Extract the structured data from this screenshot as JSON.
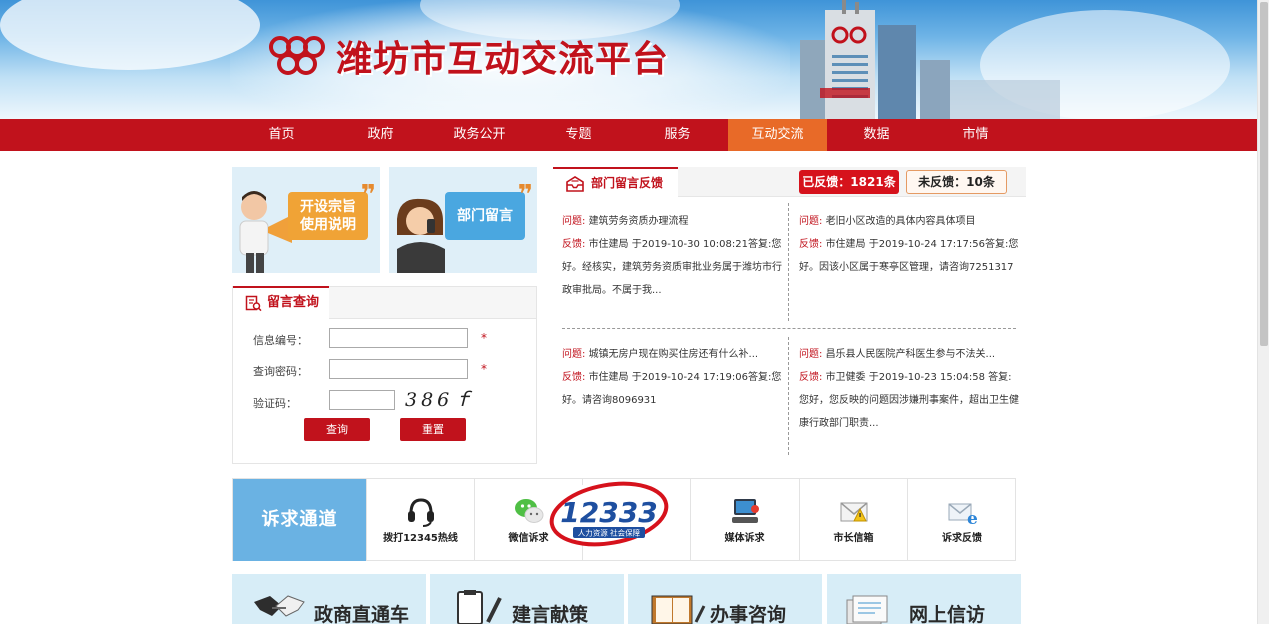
{
  "header": {
    "site_title": "潍坊市互动交流平台"
  },
  "nav": {
    "items": [
      "首页",
      "政府",
      "政务公开",
      "专题",
      "服务",
      "互动交流",
      "数据",
      "市情"
    ],
    "active": "互动交流"
  },
  "banners": {
    "left_text": "开设宗旨\n使用说明",
    "right_text": "部门留言"
  },
  "query": {
    "tab_label": "留言查询",
    "fields": {
      "id_label": "信息编号：",
      "password_label": "查询密码：",
      "captcha_label": "验证码：",
      "required_mark": "*"
    },
    "captcha_text": "386ｆ",
    "search_button": "查询",
    "reset_button": "重置"
  },
  "feedback": {
    "tab_label": "部门留言反馈",
    "replied": "已反馈：1821条",
    "unreplied": "未反馈：10条",
    "question_key": "问题:",
    "answer_key": "反馈:",
    "items": [
      {
        "question": "建筑劳务资质办理流程",
        "answer": "市住建局 于2019-10-30 10:08:21答复:您好。经核实，建筑劳务资质审批业务属于潍坊市行政审批局。不属于我..."
      },
      {
        "question": "老旧小区改造的具体内容具体项目",
        "answer": "市住建局 于2019-10-24 17:17:56答复:您好。因该小区属于寒亭区管理，请咨询7251317"
      },
      {
        "question": "城镇无房户现在购买住房还有什么补...",
        "answer": "市住建局 于2019-10-24 17:19:06答复:您好。请咨询8096931"
      },
      {
        "question": "昌乐县人民医院产科医生参与不法关...",
        "answer": "市卫健委 于2019-10-23 15:04:58 答复:您好，您反映的问题因涉嫌刑事案件，超出卫生健康行政部门职责..."
      }
    ]
  },
  "channels": {
    "title": "诉求通道",
    "items": [
      {
        "label": "拨打12345热线",
        "icon": "headset-icon"
      },
      {
        "label": "微信诉求",
        "icon": "wechat-icon"
      },
      {
        "label": "",
        "icon": "blank"
      },
      {
        "label": "媒体诉求",
        "icon": "computer-icon"
      },
      {
        "label": "市长信箱",
        "icon": "mail-icon"
      },
      {
        "label": "诉求反馈",
        "icon": "email-e-icon"
      }
    ],
    "overlay": {
      "number": "12333",
      "caption": "人力资源 社会保障"
    }
  },
  "tiles": [
    {
      "label": "政商直通车",
      "icon": "handshake-icon"
    },
    {
      "label": "建言献策",
      "icon": "clipboard-pen-icon"
    },
    {
      "label": "办事咨询",
      "icon": "notebook-icon"
    },
    {
      "label": "网上信访",
      "icon": "documents-icon"
    }
  ],
  "colors": {
    "brand_red": "#c1121c",
    "active_orange": "#e86a28",
    "light_blue": "#6ab2e3"
  }
}
